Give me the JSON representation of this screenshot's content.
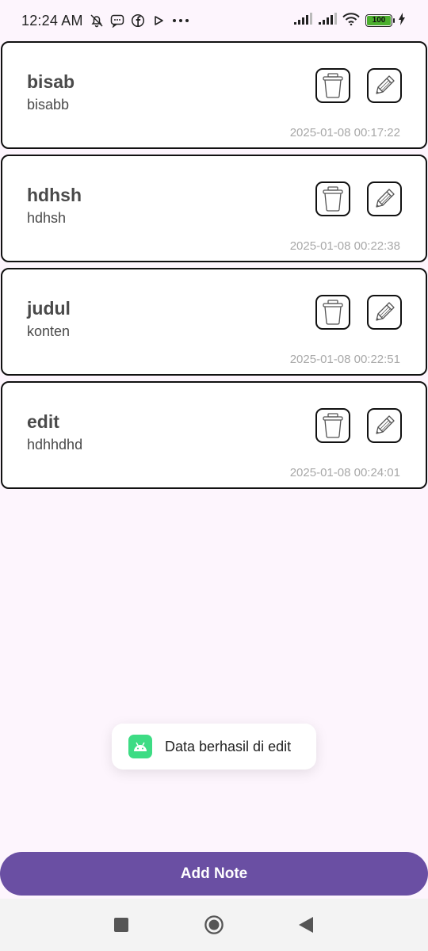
{
  "status_bar": {
    "time": "12:24 AM",
    "icons_left": [
      "mute-bell-icon",
      "message-icon",
      "facebook-icon",
      "play-icon",
      "more-dots-icon"
    ],
    "icons_right": [
      "signal-icon",
      "signal-icon",
      "wifi-icon",
      "battery-icon",
      "charging-icon"
    ],
    "more": "···",
    "battery_level": "100",
    "battery_color": "#4caf2e"
  },
  "notes": [
    {
      "title": "bisab",
      "content": "bisabb",
      "timestamp": "2025-01-08 00:17:22"
    },
    {
      "title": "hdhsh",
      "content": "hdhsh",
      "timestamp": "2025-01-08 00:22:38"
    },
    {
      "title": "judul",
      "content": "konten",
      "timestamp": "2025-01-08 00:22:51"
    },
    {
      "title": "edit",
      "content": "hdhhdhd",
      "timestamp": "2025-01-08 00:24:01"
    }
  ],
  "note_actions": {
    "delete_icon": "trash-icon",
    "edit_icon": "pencil-icon"
  },
  "toast": {
    "message": "Data berhasil di edit",
    "icon": "android-icon"
  },
  "add_button": {
    "label": "Add Note",
    "color": "#6a4fa3"
  },
  "nav_bar": {
    "buttons": [
      "recents-icon",
      "home-icon",
      "back-icon"
    ]
  }
}
